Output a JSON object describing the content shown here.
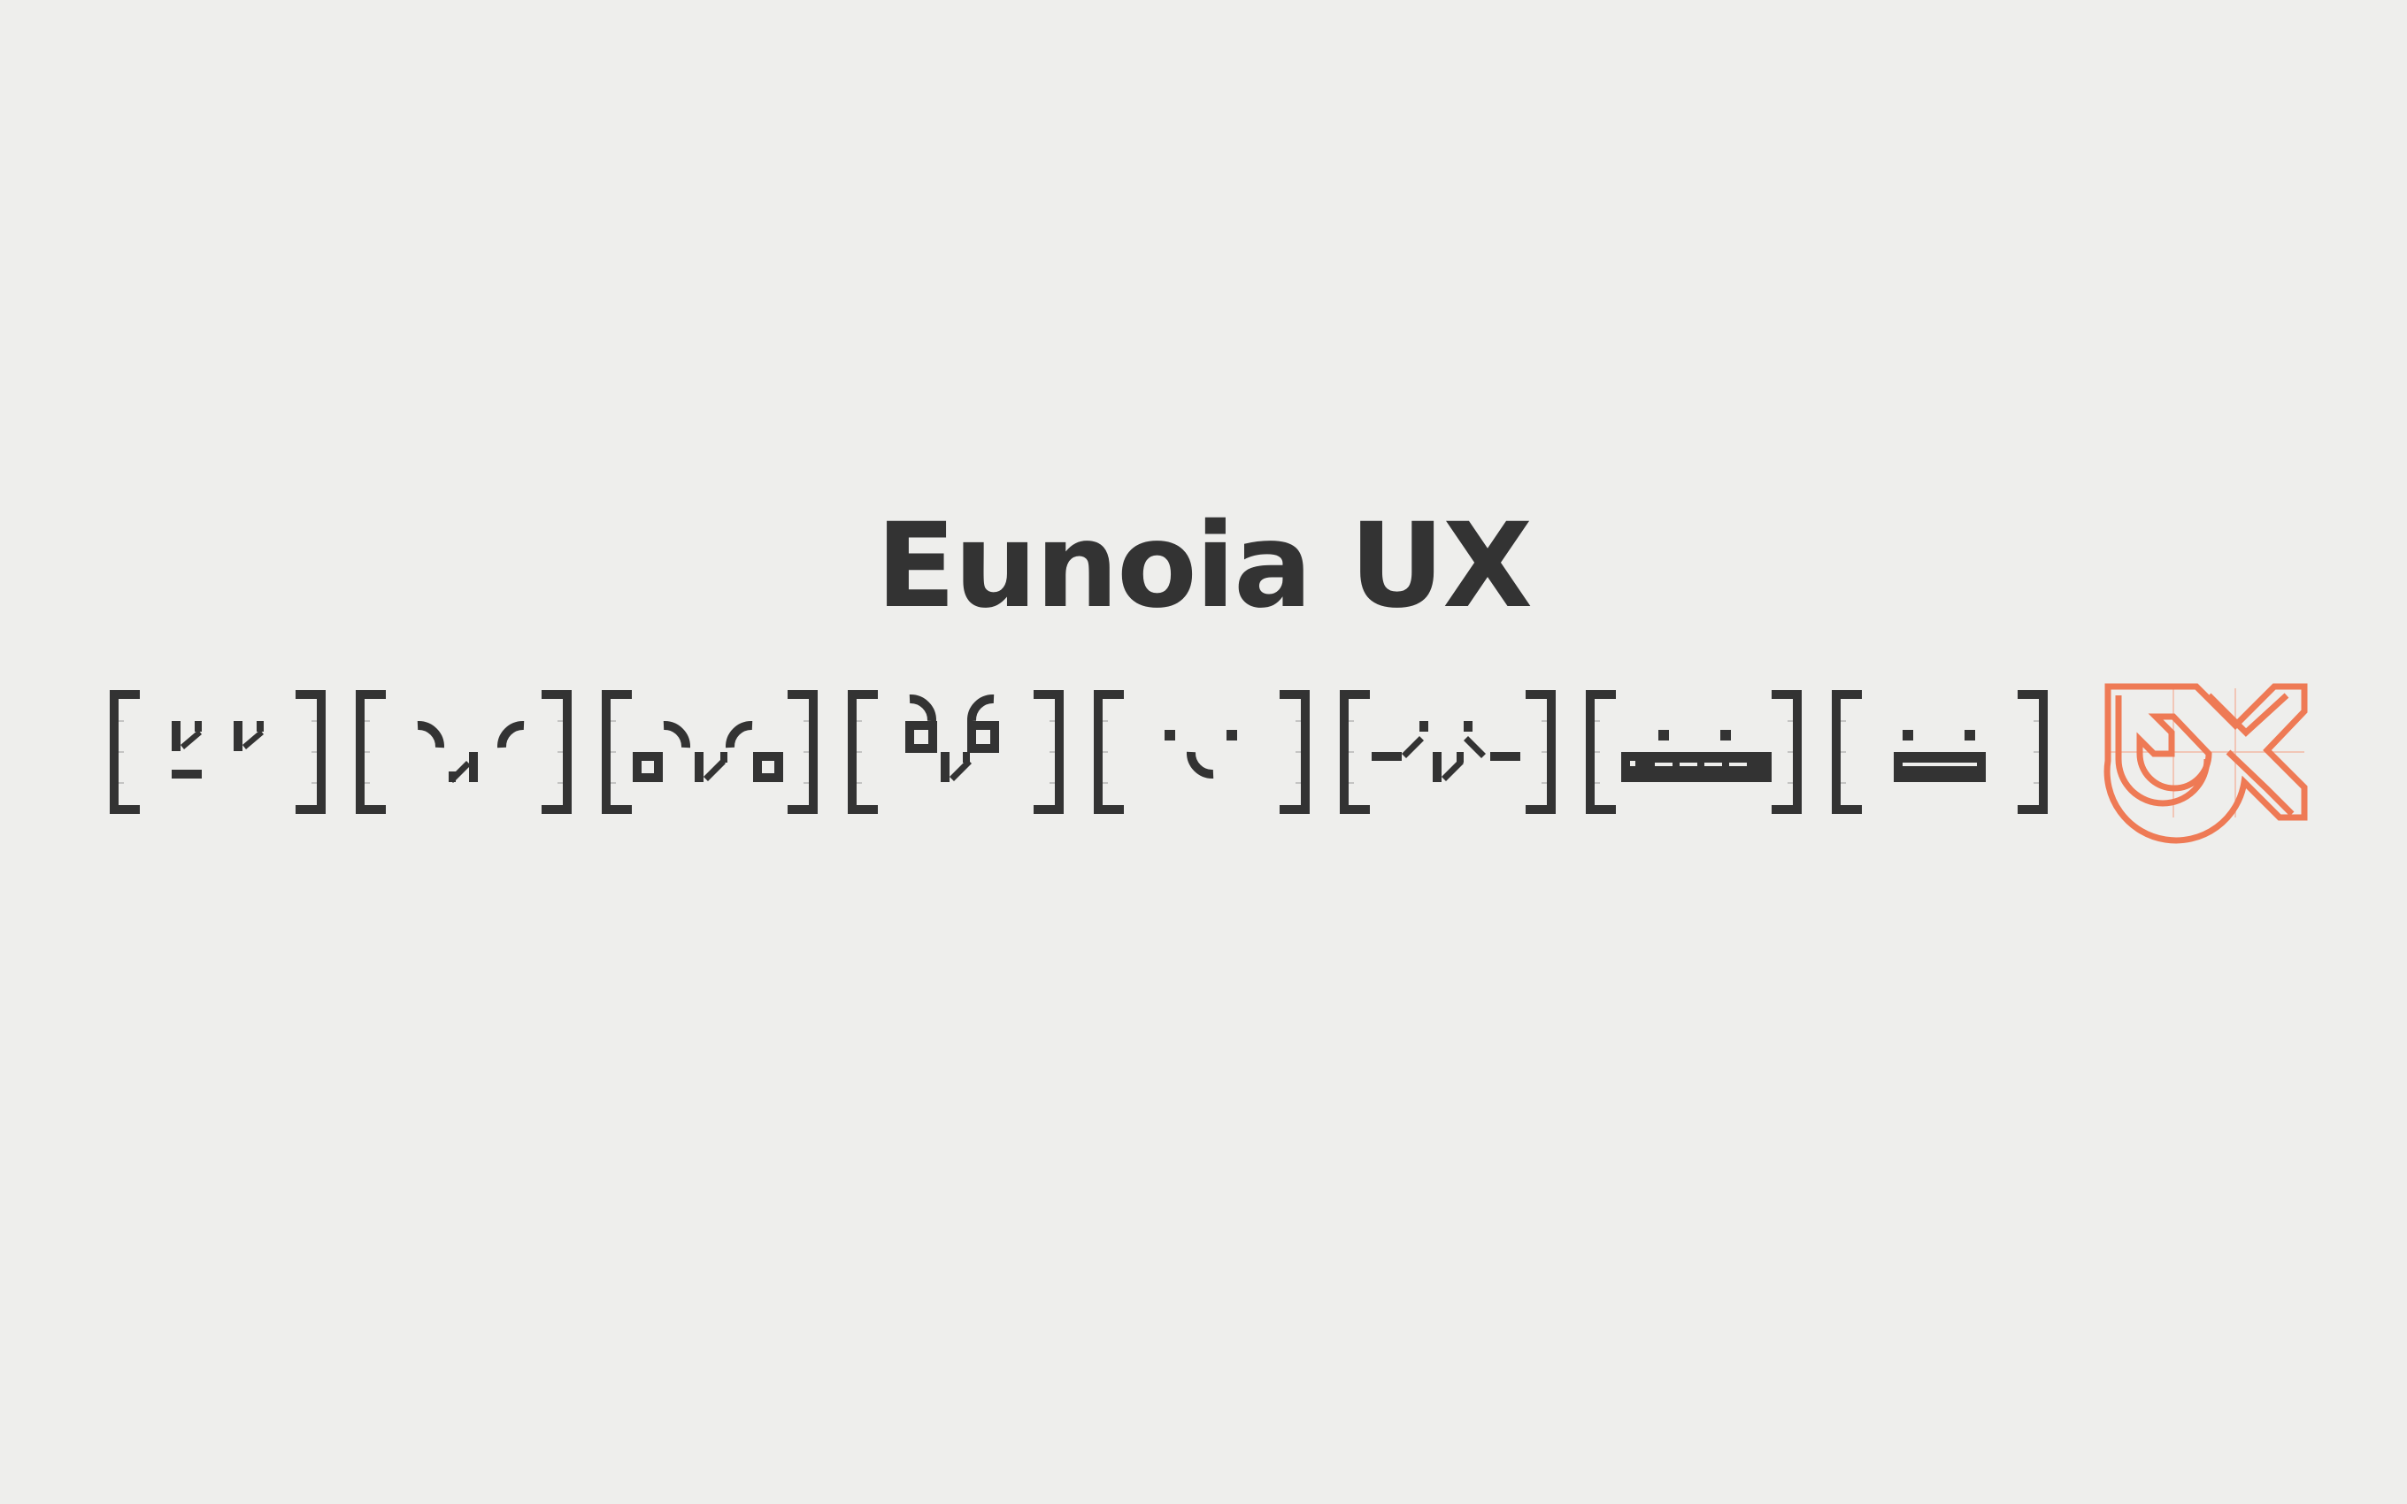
{
  "brand": {
    "wordmark": "Eunoia UX"
  },
  "colors": {
    "background": "#eeeeec",
    "ink": "#333333",
    "accent": "#ee7a55",
    "accent_light": "#f2b9a5"
  },
  "glyph_set": {
    "bracket_groups": 8,
    "icons": [
      "bracket-group-1",
      "bracket-group-2",
      "bracket-group-3",
      "bracket-group-4",
      "bracket-group-5",
      "bracket-group-6",
      "bracket-group-7",
      "bracket-group-8",
      "eunoia-ux-monogram-icon"
    ]
  }
}
